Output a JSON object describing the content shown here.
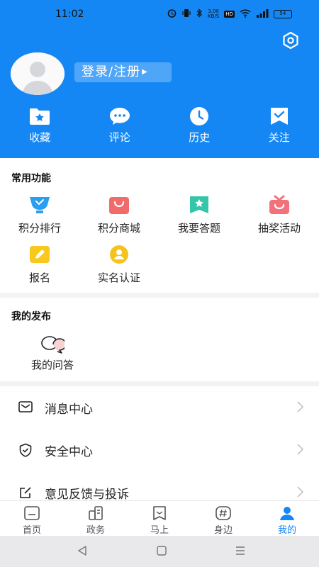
{
  "status_bar": {
    "time": "11:02",
    "net_speed_value": "3.00",
    "net_speed_unit": "KB/S",
    "hd_label": "HD",
    "battery_level": "54"
  },
  "profile": {
    "login_label": "登录/注册"
  },
  "quick_actions": [
    {
      "icon": "star-folder-icon",
      "label": "收藏"
    },
    {
      "icon": "comment-bubble-icon",
      "label": "评论"
    },
    {
      "icon": "clock-icon",
      "label": "历史"
    },
    {
      "icon": "follow-check-icon",
      "label": "关注"
    }
  ],
  "common_functions": {
    "title": "常用功能",
    "items": [
      {
        "icon": "trophy-icon",
        "label": "积分排行"
      },
      {
        "icon": "shopping-bag-icon",
        "label": "积分商城"
      },
      {
        "icon": "star-bookmark-icon",
        "label": "我要答题"
      },
      {
        "icon": "gift-icon",
        "label": "抽奖活动"
      },
      {
        "icon": "pencil-icon",
        "label": "报名"
      },
      {
        "icon": "person-badge-icon",
        "label": "实名认证"
      }
    ]
  },
  "my_posts": {
    "title": "我的发布",
    "items": [
      {
        "icon": "qa-bubbles-icon",
        "label": "我的问答"
      }
    ]
  },
  "menu": [
    {
      "icon": "mail-icon",
      "label": "消息中心"
    },
    {
      "icon": "shield-check-icon",
      "label": "安全中心"
    },
    {
      "icon": "edit-square-icon",
      "label": "意见反馈与投诉"
    }
  ],
  "tabs": [
    {
      "icon": "home-icon",
      "label": "首页"
    },
    {
      "icon": "government-icon",
      "label": "政务"
    },
    {
      "icon": "flag-icon",
      "label": "马上"
    },
    {
      "icon": "hashtag-icon",
      "label": "身边"
    },
    {
      "icon": "user-icon",
      "label": "我的",
      "active": true
    }
  ],
  "colors": {
    "brand": "#1487f5",
    "active_tab": "#1487f5"
  }
}
